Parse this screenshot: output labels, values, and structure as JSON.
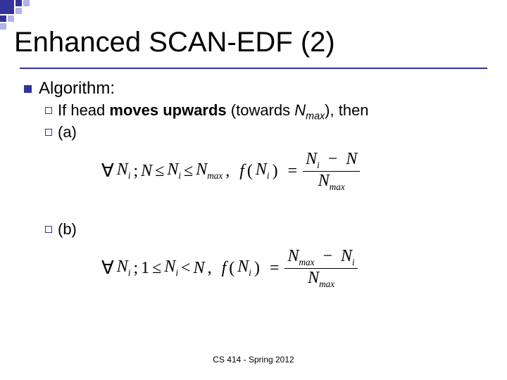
{
  "title": "Enhanced SCAN-EDF (2)",
  "algorithm_label": "Algorithm:",
  "if_line_pre": "If head ",
  "if_line_bold": "moves upwards",
  "if_line_post": " (towards ",
  "if_line_N": "N",
  "if_line_sub": "max",
  "if_line_end": "), then",
  "case_a_label": "(a)",
  "case_b_label": "(b)",
  "formula_a": {
    "prefix": "∀",
    "var": "N",
    "sep": ";",
    "lhs_low": "N",
    "rel1": "≤",
    "mid": "N",
    "rel2": "≤",
    "rhs_hi": "N",
    "comma": ",",
    "f": "f",
    "paren_open": "(",
    "arg": "N",
    "paren_close": ")",
    "eq": "=",
    "num_l": "N",
    "num_minus": "−",
    "num_r": "N",
    "den": "N",
    "i": "i",
    "max": "max"
  },
  "formula_b": {
    "prefix": "∀",
    "var": "N",
    "sep": ";",
    "lhs_low": "1",
    "rel1": "≤",
    "mid": "N",
    "rel2": "<",
    "rhs_hi": "N",
    "comma": ",",
    "f": "f",
    "paren_open": "(",
    "arg": "N",
    "paren_close": ")",
    "eq": "=",
    "num_l": "N",
    "num_minus": "−",
    "num_r": "N",
    "den": "N",
    "i": "i",
    "max": "max"
  },
  "footer": "CS 414 - Spring 2012"
}
